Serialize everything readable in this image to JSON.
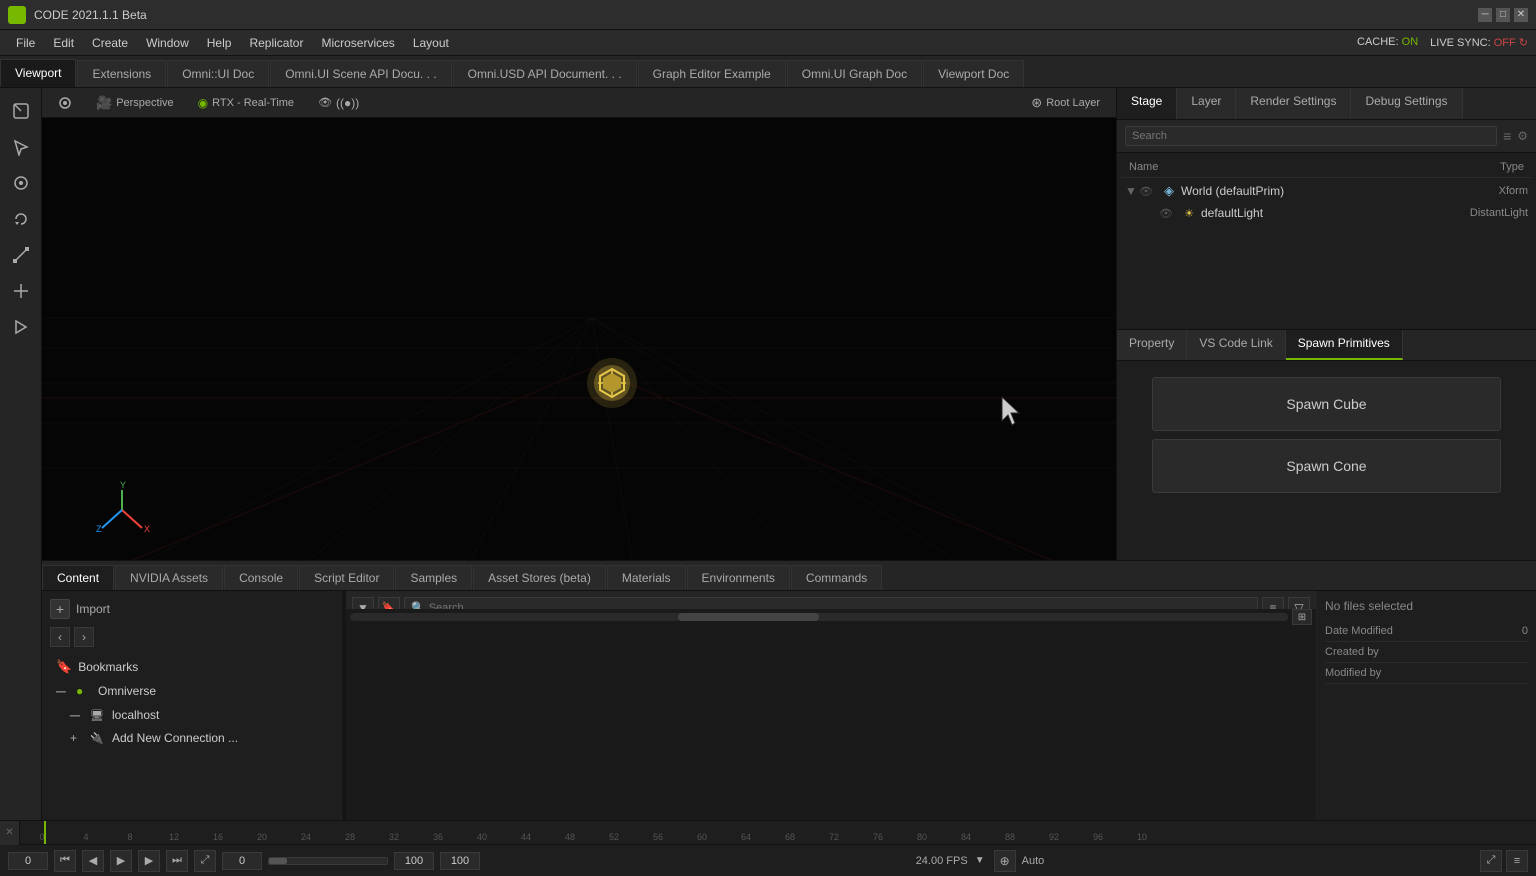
{
  "titlebar": {
    "app_name": "CODE 2021.1.1 Beta",
    "icon_text": "▶"
  },
  "menubar": {
    "items": [
      "File",
      "Edit",
      "Create",
      "Window",
      "Help",
      "Replicator",
      "Microservices",
      "Layout"
    ],
    "cache_label": "CACHE:",
    "cache_status": "ON",
    "live_sync_label": "LIVE SYNC:",
    "live_sync_status": "OFF ↻"
  },
  "tabs": [
    {
      "label": "Viewport",
      "active": true
    },
    {
      "label": "Extensions"
    },
    {
      "label": "Omni::UI Doc"
    },
    {
      "label": "Omni.UI Scene API Docu. . ."
    },
    {
      "label": "Omni.USD API Document. . ."
    },
    {
      "label": "Graph Editor Example"
    },
    {
      "label": "Omni.UI Graph Doc"
    },
    {
      "label": "Viewport Doc"
    }
  ],
  "viewport": {
    "camera_icon": "🎥",
    "perspective_label": "Perspective",
    "rtx_icon": "◉",
    "rtx_label": "RTX - Real-Time",
    "eye_icon": "👁",
    "layer_icon": "⊛",
    "layer_label": "Root Layer",
    "settings_icon": "⚙"
  },
  "right_panel": {
    "tabs": [
      {
        "label": "Stage",
        "active": true
      },
      {
        "label": "Layer"
      },
      {
        "label": "Render Settings"
      },
      {
        "label": "Debug Settings"
      }
    ],
    "search_placeholder": "Search",
    "filter_icon": "≡",
    "tree": {
      "col_name": "Name",
      "col_type": "Type",
      "items": [
        {
          "label": "World (defaultPrim)",
          "type": "Xform",
          "icon": "world",
          "expanded": true
        },
        {
          "label": "defaultLight",
          "type": "DistantLight",
          "icon": "light",
          "child": true
        }
      ]
    }
  },
  "bottom_right_tabs": [
    {
      "label": "Property"
    },
    {
      "label": "VS Code Link"
    },
    {
      "label": "Spawn Primitives",
      "active": true
    }
  ],
  "spawn_panel": {
    "spawn_cube_label": "Spawn Cube",
    "spawn_cone_label": "Spawn Cone"
  },
  "content": {
    "tabs": [
      {
        "label": "Content",
        "active": true
      },
      {
        "label": "NVIDIA Assets"
      },
      {
        "label": "Console"
      },
      {
        "label": "Script Editor"
      },
      {
        "label": "Samples"
      },
      {
        "label": "Asset Stores (beta)"
      },
      {
        "label": "Materials"
      },
      {
        "label": "Environments"
      },
      {
        "label": "Commands"
      }
    ],
    "import_label": "Import",
    "sidebar_items": [
      {
        "label": "Bookmarks",
        "icon": "bookmark",
        "indent": 0
      },
      {
        "label": "Omniverse",
        "icon": "omniverse",
        "indent": 0,
        "expanded": true
      },
      {
        "label": "localhost",
        "icon": "host",
        "indent": 1,
        "expanded": true
      },
      {
        "label": "Add New Connection ...",
        "icon": "add",
        "indent": 1
      }
    ],
    "file_info": {
      "no_files_label": "No files selected",
      "date_modified_label": "Date Modified",
      "date_modified_value": "0",
      "created_by_label": "Created by",
      "modified_by_label": "Modified by"
    }
  },
  "timeline": {
    "numbers": [
      "0",
      "4",
      "8",
      "12",
      "16",
      "20",
      "24",
      "28",
      "32",
      "36",
      "40",
      "44",
      "48",
      "52",
      "56",
      "60",
      "64",
      "68",
      "72",
      "76",
      "80",
      "84",
      "88",
      "92",
      "96",
      "10"
    ],
    "start_frame": "0",
    "start_frame2": "0",
    "end_frame": "100",
    "end_frame2": "100",
    "fps_label": "24.00 FPS",
    "auto_label": "Auto"
  }
}
